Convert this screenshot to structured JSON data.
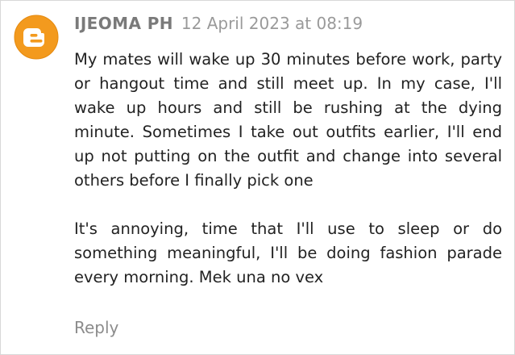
{
  "comment": {
    "avatar_icon": "blogger-logo-icon",
    "avatar_color": "#f39a1e",
    "author": "IJEOMA PH",
    "timestamp": "12 April 2023 at 08:19",
    "paragraphs": [
      "My mates will wake up 30 minutes before work, party or hangout time and still meet up. In my case, I'll wake up hours and still be rushing at the dying minute. Sometimes I take out outfits earlier, I'll end up not putting on the outfit and change into several others before I finally pick one",
      "It's annoying, time that I'll use to sleep or do something meaningful, I'll be doing fashion parade every morning. Mek una no vex"
    ],
    "reply_label": "Reply"
  }
}
